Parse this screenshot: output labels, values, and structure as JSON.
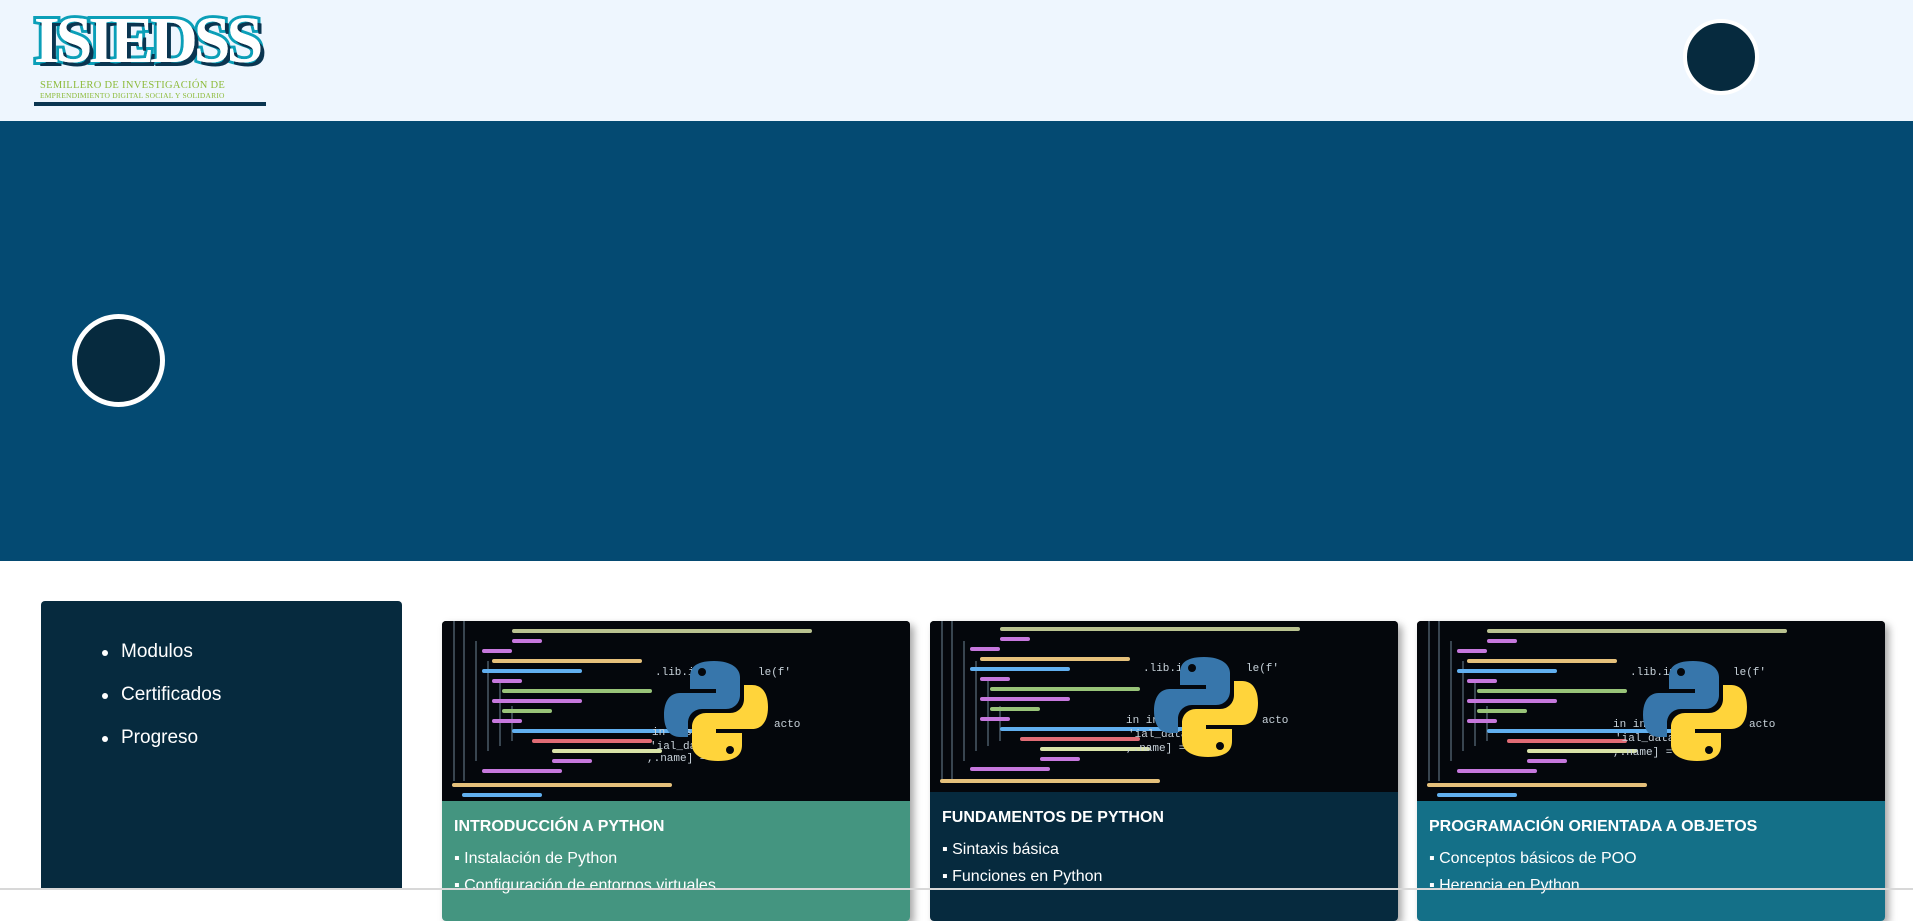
{
  "logo": {
    "wordmark": "ISIEDSS",
    "line1": "SEMILLERO DE INVESTIGACIÓN DE",
    "line2": "EMPRENDIMIENTO DIGITAL SOCIAL Y SOLIDARIO"
  },
  "colors": {
    "header_bg": "#eef6fe",
    "hero_bg": "#044a72",
    "sidebar_bg": "#062a3e",
    "card1_bg": "#449580",
    "card2_bg": "#062a3e",
    "card3_bg": "#147088",
    "logo_teal": "#0b9fb8",
    "logo_green": "#8dbb3a"
  },
  "sidebar": {
    "items": [
      {
        "label": "Modulos"
      },
      {
        "label": "Certificados"
      },
      {
        "label": "Progreso"
      }
    ]
  },
  "cards": [
    {
      "title": "INTRODUCCIÓN A PYTHON",
      "items": [
        "Instalación de Python",
        "Configuración de entornos virtuales"
      ],
      "image_icon": "python-code-image"
    },
    {
      "title": "FUNDAMENTOS DE PYTHON",
      "items": [
        "Sintaxis básica",
        "Funciones en Python"
      ],
      "image_icon": "python-code-image"
    },
    {
      "title": "PROGRAMACIÓN ORIENTADA A OBJETOS",
      "items": [
        "Conceptos básicos de POO",
        "Herencia en Python"
      ],
      "image_icon": "python-code-image"
    }
  ]
}
